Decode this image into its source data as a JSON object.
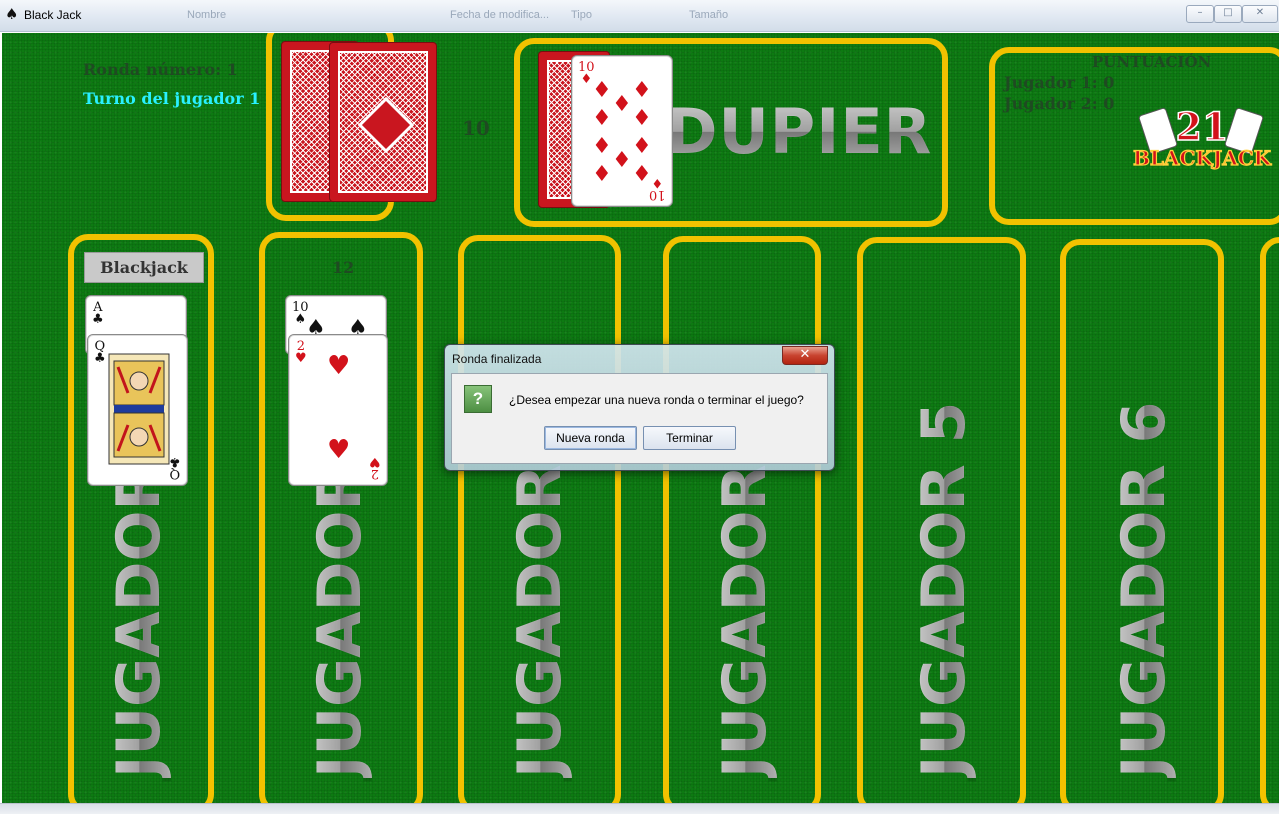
{
  "window": {
    "title": "Black Jack",
    "icon": "spade-icon",
    "ghost_headers": [
      "Nombre",
      "Fecha de modifica...",
      "Tipo",
      "Tamaño"
    ]
  },
  "game": {
    "round_label": "Ronda número: 1",
    "turn_label": "Turno del jugador 1",
    "deck_value": "10",
    "dealer_label": "DUPIER",
    "score": {
      "title": "PUNTUACIÓN",
      "lines": [
        "Jugador 1: 0",
        "Jugador 2: 0"
      ]
    },
    "logo_text": {
      "number": "21",
      "word": "BLACKJACK"
    },
    "players": [
      {
        "label": "JUGADOR 1",
        "status": "Blackjack",
        "cards": [
          {
            "rank": "A",
            "suit": "♣"
          },
          {
            "rank": "Q",
            "suit": "♣"
          }
        ]
      },
      {
        "label": "JUGADOR 2",
        "status": "12",
        "cards": [
          {
            "rank": "10",
            "suit": "♠"
          },
          {
            "rank": "2",
            "suit": "♥"
          }
        ]
      },
      {
        "label": "JUGADOR 3"
      },
      {
        "label": "JUGADOR 4"
      },
      {
        "label": "JUGADOR 5"
      },
      {
        "label": "JUGADOR 6"
      }
    ],
    "dealer_card": {
      "rank": "10",
      "suit": "♦"
    }
  },
  "dialog": {
    "title": "Ronda finalizada",
    "close_label": "✕",
    "icon": "question-icon",
    "icon_glyph": "?",
    "message": "¿Desea empezar una nueva ronda o terminar el juego?",
    "buttons": {
      "new_round": "Nueva ronda",
      "finish": "Terminar"
    }
  },
  "colors": {
    "table": "#0d7a12",
    "frame": "#f2c200",
    "turn": "#29f0ff"
  }
}
